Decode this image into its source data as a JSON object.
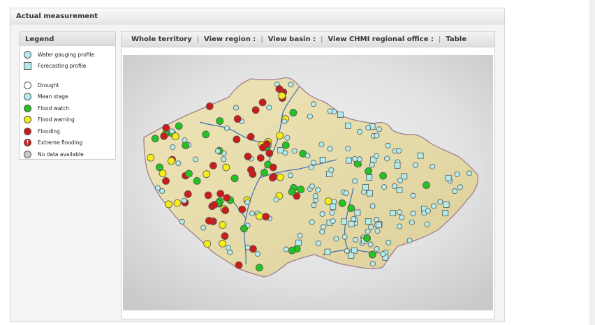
{
  "window": {
    "title": "Actual measurement"
  },
  "legend": {
    "title": "Legend",
    "items": [
      {
        "label": "Water gauging profile",
        "shape": "circle",
        "color": "#b3ecec",
        "icon": "water-gauging-profile-icon"
      },
      {
        "label": "Forecasting profile",
        "shape": "square",
        "color": "#b3ecec",
        "icon": "forecasting-profile-icon"
      },
      {
        "label": "Drought",
        "shape": "circle",
        "color": "#ffffff",
        "icon": "drought-icon"
      },
      {
        "label": "Mean stage",
        "shape": "circle",
        "color": "#b3ecec",
        "icon": "mean-stage-icon"
      },
      {
        "label": "Flood watch",
        "shape": "circle",
        "color": "#22c322",
        "icon": "flood-watch-icon"
      },
      {
        "label": "Flood warning",
        "shape": "circle",
        "color": "#f5ec18",
        "icon": "flood-warning-icon"
      },
      {
        "label": "Flooding",
        "shape": "circle",
        "color": "#cc1b1b",
        "icon": "flooding-icon"
      },
      {
        "label": "Extreme flooding",
        "shape": "excl",
        "color": "#cc1b1b",
        "icon": "extreme-flooding-icon"
      },
      {
        "label": "No data available",
        "shape": "circle",
        "color": "#c8c8c8",
        "icon": "no-data-icon"
      }
    ]
  },
  "nav": {
    "whole_territory": "Whole territory",
    "view_region": "View region :",
    "view_basin": "View basin :",
    "view_chmi_office": "View CHMI regional office :",
    "table": "Table"
  },
  "map": {
    "colors": {
      "background": "#eeeeee",
      "land": "#eadfb0",
      "border": "#a07d93",
      "river": "#3d6db5",
      "gauge": "#b3ecec",
      "watch": "#22c322",
      "warning": "#f5ec18",
      "flooding": "#cc1b1b"
    }
  }
}
